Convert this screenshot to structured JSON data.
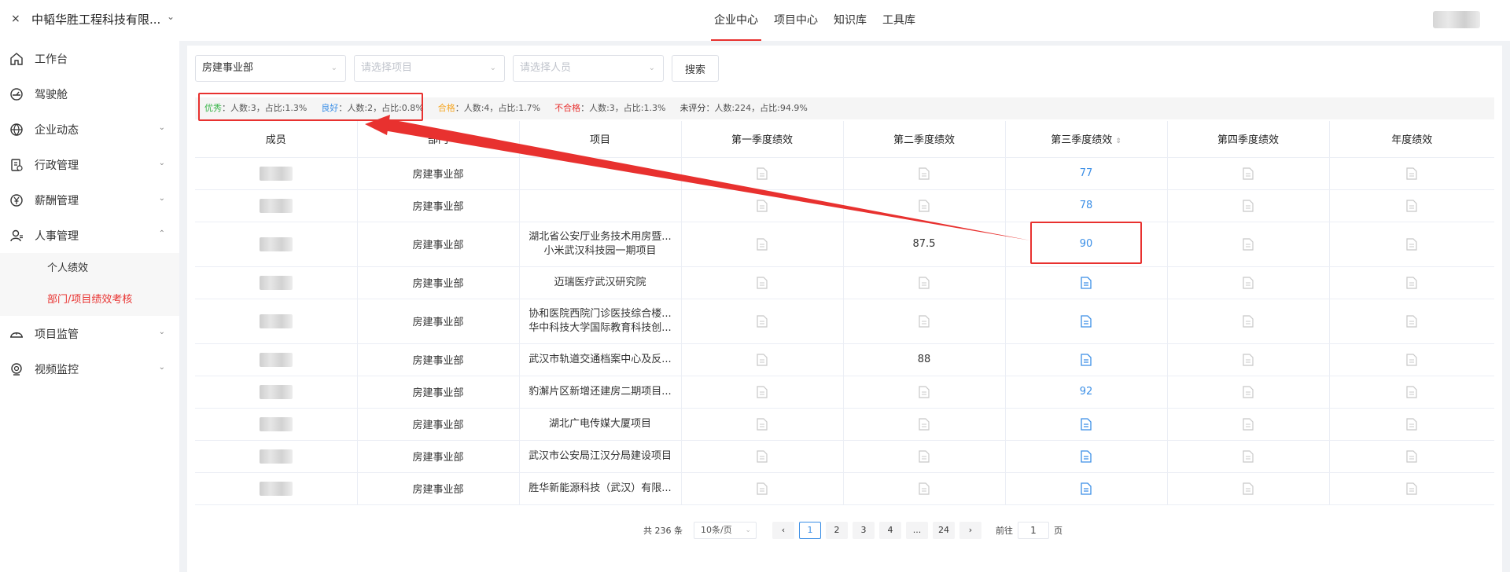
{
  "header": {
    "close_glyph": "×",
    "company": "中韬华胜工程科技有限...",
    "nav": [
      {
        "label": "企业中心",
        "active": true
      },
      {
        "label": "项目中心",
        "active": false
      },
      {
        "label": "知识库",
        "active": false
      },
      {
        "label": "工具库",
        "active": false
      }
    ]
  },
  "sidebar": {
    "items": [
      {
        "label": "工作台",
        "icon": "home-icon",
        "caret": ""
      },
      {
        "label": "驾驶舱",
        "icon": "dashboard-icon",
        "caret": ""
      },
      {
        "label": "企业动态",
        "icon": "globe-icon",
        "caret": "⌄"
      },
      {
        "label": "行政管理",
        "icon": "admin-icon",
        "caret": "⌄"
      },
      {
        "label": "薪酬管理",
        "icon": "yen-icon",
        "caret": "⌄"
      },
      {
        "label": "人事管理",
        "icon": "user-icon",
        "caret": "⌃"
      },
      {
        "label": "项目监管",
        "icon": "helmet-icon",
        "caret": "⌄"
      },
      {
        "label": "视频监控",
        "icon": "camera-icon",
        "caret": "⌄"
      }
    ],
    "sub_items": [
      {
        "label": "个人绩效",
        "active": false
      },
      {
        "label": "部门/项目绩效考核",
        "active": true
      }
    ]
  },
  "filters": {
    "department": "房建事业部",
    "project_placeholder": "请选择项目",
    "person_placeholder": "请选择人员",
    "search_label": "搜索"
  },
  "stats": [
    {
      "label": "优秀",
      "text": "：人数:3，占比:1.3%"
    },
    {
      "label": "良好",
      "text": "：人数:2，占比:0.8%"
    },
    {
      "label": "合格",
      "text": "：人数:4，占比:1.7%"
    },
    {
      "label": "不合格",
      "text": "：人数:3，占比:1.3%"
    },
    {
      "label": "未评分",
      "text": "：人数:224，占比:94.9%"
    }
  ],
  "table": {
    "headers": [
      "成员",
      "部门",
      "项目",
      "第一季度绩效",
      "第二季度绩效",
      "第三季度绩效",
      "第四季度绩效",
      "年度绩效"
    ],
    "rows": [
      {
        "dept": "房建事业部",
        "project": [],
        "q2": "",
        "q3": "77"
      },
      {
        "dept": "房建事业部",
        "project": [],
        "q2": "",
        "q3": "78"
      },
      {
        "dept": "房建事业部",
        "project": [
          "湖北省公安厅业务技术用房暨...",
          "小米武汉科技园一期项目"
        ],
        "q2": "87.5",
        "q3": "90"
      },
      {
        "dept": "房建事业部",
        "project": [
          "迈瑞医疗武汉研究院"
        ],
        "q2": "",
        "q3": ""
      },
      {
        "dept": "房建事业部",
        "project": [
          "协和医院西院门诊医技综合楼...",
          "华中科技大学国际教育科技创..."
        ],
        "q2": "",
        "q3": ""
      },
      {
        "dept": "房建事业部",
        "project": [
          "武汉市轨道交通档案中心及反..."
        ],
        "q2": "88",
        "q3": ""
      },
      {
        "dept": "房建事业部",
        "project": [
          "豹澥片区新增还建房二期项目..."
        ],
        "q2": "",
        "q3": "92"
      },
      {
        "dept": "房建事业部",
        "project": [
          "湖北广电传媒大厦项目"
        ],
        "q2": "",
        "q3": ""
      },
      {
        "dept": "房建事业部",
        "project": [
          "武汉市公安局江汉分局建设项目"
        ],
        "q2": "",
        "q3": ""
      },
      {
        "dept": "房建事业部",
        "project": [
          "胜华新能源科技（武汉）有限..."
        ],
        "q2": "",
        "q3": ""
      }
    ]
  },
  "pagination": {
    "total": "共 236 条",
    "page_size": "10条/页",
    "pages": [
      "1",
      "2",
      "3",
      "4",
      "...",
      "24"
    ],
    "current": "1",
    "prev": "‹",
    "next": "›",
    "goto_label": "前往",
    "goto_value": "1",
    "goto_suffix": "页"
  },
  "colors": {
    "accent_red": "#e8312f",
    "link_blue": "#3a8ee6"
  }
}
